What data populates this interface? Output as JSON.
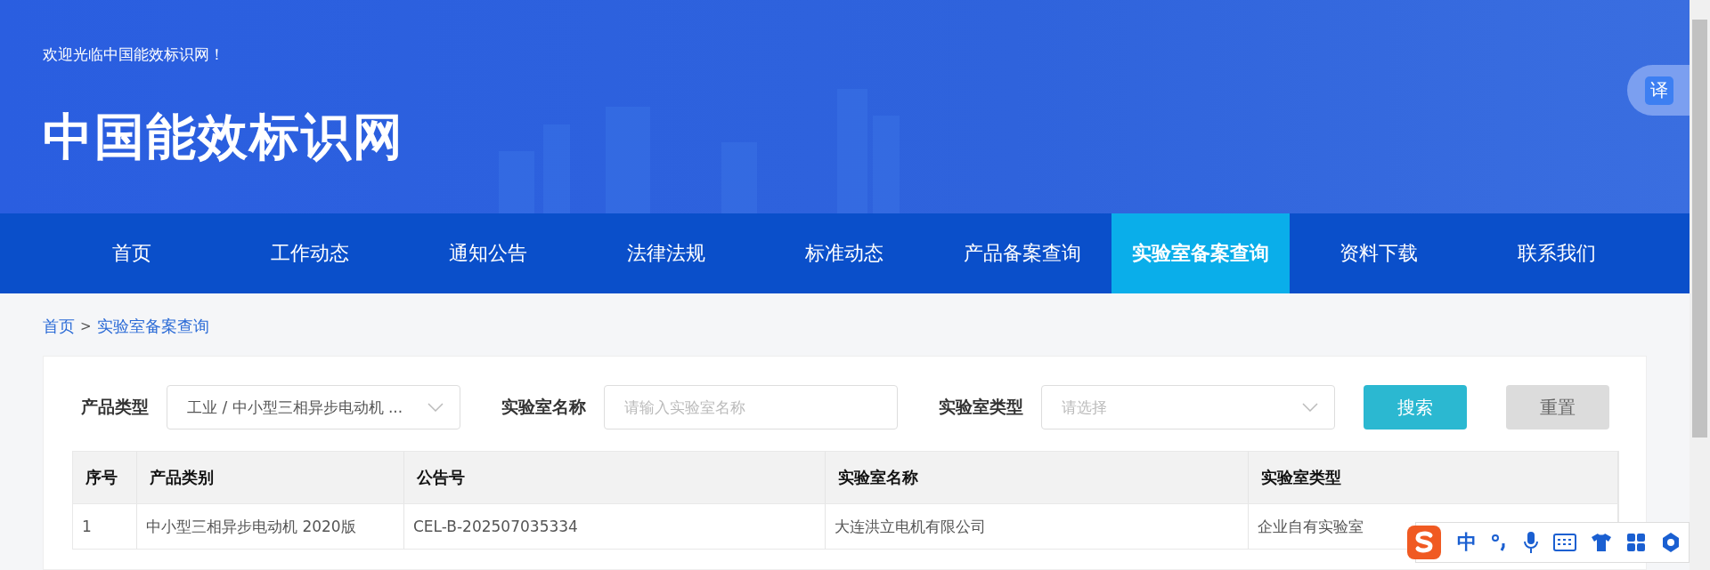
{
  "header": {
    "welcome": "欢迎光临中国能效标识网！",
    "logo": "中国能效标识网",
    "translate": "译"
  },
  "nav": [
    {
      "label": "首页",
      "selected": false
    },
    {
      "label": "工作动态",
      "selected": false
    },
    {
      "label": "通知公告",
      "selected": false
    },
    {
      "label": "法律法规",
      "selected": false
    },
    {
      "label": "标准动态",
      "selected": false
    },
    {
      "label": "产品备案查询",
      "selected": false
    },
    {
      "label": "实验室备案查询",
      "selected": true
    },
    {
      "label": "资料下载",
      "selected": false
    },
    {
      "label": "联系我们",
      "selected": false
    }
  ],
  "breadcrumb": {
    "home": "首页",
    "separator": ">",
    "current": "实验室备案查询"
  },
  "filters": [
    {
      "kind": "select",
      "label": "产品类型",
      "value": "工业 / 中小型三相异步电动机 ..."
    },
    {
      "kind": "input",
      "label": "实验室名称",
      "placeholder": "请输入实验室名称"
    },
    {
      "kind": "select",
      "label": "实验室类型",
      "placeholder": "请选择"
    }
  ],
  "buttons": {
    "search": "搜索",
    "reset": "重置"
  },
  "table": {
    "columns": [
      "序号",
      "产品类别",
      "公告号",
      "实验室名称",
      "实验室类型"
    ],
    "rows": [
      [
        "1",
        "中小型三相异步电动机 2020版",
        "CEL-B-202507035334",
        "大连洪立电机有限公司",
        "企业自有实验室"
      ]
    ]
  },
  "ime_toolbar": {
    "mode": "中"
  }
}
